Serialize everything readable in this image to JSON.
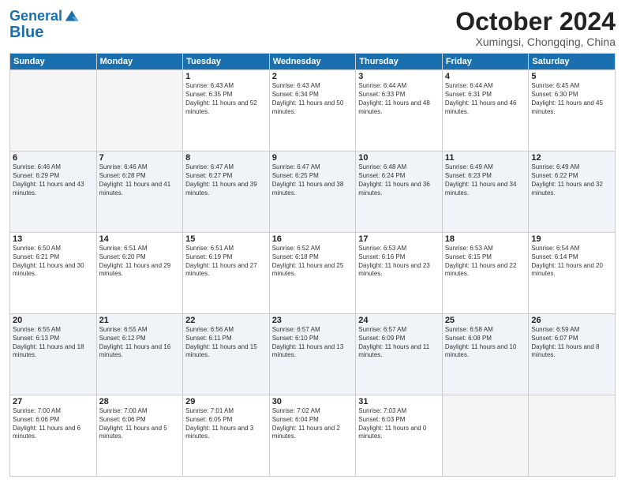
{
  "header": {
    "logo_line1": "General",
    "logo_line2": "Blue",
    "month": "October 2024",
    "location": "Xumingsi, Chongqing, China"
  },
  "weekdays": [
    "Sunday",
    "Monday",
    "Tuesday",
    "Wednesday",
    "Thursday",
    "Friday",
    "Saturday"
  ],
  "weeks": [
    [
      {
        "day": "",
        "info": ""
      },
      {
        "day": "",
        "info": ""
      },
      {
        "day": "1",
        "info": "Sunrise: 6:43 AM\nSunset: 6:35 PM\nDaylight: 11 hours and 52 minutes."
      },
      {
        "day": "2",
        "info": "Sunrise: 6:43 AM\nSunset: 6:34 PM\nDaylight: 11 hours and 50 minutes."
      },
      {
        "day": "3",
        "info": "Sunrise: 6:44 AM\nSunset: 6:33 PM\nDaylight: 11 hours and 48 minutes."
      },
      {
        "day": "4",
        "info": "Sunrise: 6:44 AM\nSunset: 6:31 PM\nDaylight: 11 hours and 46 minutes."
      },
      {
        "day": "5",
        "info": "Sunrise: 6:45 AM\nSunset: 6:30 PM\nDaylight: 11 hours and 45 minutes."
      }
    ],
    [
      {
        "day": "6",
        "info": "Sunrise: 6:46 AM\nSunset: 6:29 PM\nDaylight: 11 hours and 43 minutes."
      },
      {
        "day": "7",
        "info": "Sunrise: 6:46 AM\nSunset: 6:28 PM\nDaylight: 11 hours and 41 minutes."
      },
      {
        "day": "8",
        "info": "Sunrise: 6:47 AM\nSunset: 6:27 PM\nDaylight: 11 hours and 39 minutes."
      },
      {
        "day": "9",
        "info": "Sunrise: 6:47 AM\nSunset: 6:25 PM\nDaylight: 11 hours and 38 minutes."
      },
      {
        "day": "10",
        "info": "Sunrise: 6:48 AM\nSunset: 6:24 PM\nDaylight: 11 hours and 36 minutes."
      },
      {
        "day": "11",
        "info": "Sunrise: 6:49 AM\nSunset: 6:23 PM\nDaylight: 11 hours and 34 minutes."
      },
      {
        "day": "12",
        "info": "Sunrise: 6:49 AM\nSunset: 6:22 PM\nDaylight: 11 hours and 32 minutes."
      }
    ],
    [
      {
        "day": "13",
        "info": "Sunrise: 6:50 AM\nSunset: 6:21 PM\nDaylight: 11 hours and 30 minutes."
      },
      {
        "day": "14",
        "info": "Sunrise: 6:51 AM\nSunset: 6:20 PM\nDaylight: 11 hours and 29 minutes."
      },
      {
        "day": "15",
        "info": "Sunrise: 6:51 AM\nSunset: 6:19 PM\nDaylight: 11 hours and 27 minutes."
      },
      {
        "day": "16",
        "info": "Sunrise: 6:52 AM\nSunset: 6:18 PM\nDaylight: 11 hours and 25 minutes."
      },
      {
        "day": "17",
        "info": "Sunrise: 6:53 AM\nSunset: 6:16 PM\nDaylight: 11 hours and 23 minutes."
      },
      {
        "day": "18",
        "info": "Sunrise: 6:53 AM\nSunset: 6:15 PM\nDaylight: 11 hours and 22 minutes."
      },
      {
        "day": "19",
        "info": "Sunrise: 6:54 AM\nSunset: 6:14 PM\nDaylight: 11 hours and 20 minutes."
      }
    ],
    [
      {
        "day": "20",
        "info": "Sunrise: 6:55 AM\nSunset: 6:13 PM\nDaylight: 11 hours and 18 minutes."
      },
      {
        "day": "21",
        "info": "Sunrise: 6:55 AM\nSunset: 6:12 PM\nDaylight: 11 hours and 16 minutes."
      },
      {
        "day": "22",
        "info": "Sunrise: 6:56 AM\nSunset: 6:11 PM\nDaylight: 11 hours and 15 minutes."
      },
      {
        "day": "23",
        "info": "Sunrise: 6:57 AM\nSunset: 6:10 PM\nDaylight: 11 hours and 13 minutes."
      },
      {
        "day": "24",
        "info": "Sunrise: 6:57 AM\nSunset: 6:09 PM\nDaylight: 11 hours and 11 minutes."
      },
      {
        "day": "25",
        "info": "Sunrise: 6:58 AM\nSunset: 6:08 PM\nDaylight: 11 hours and 10 minutes."
      },
      {
        "day": "26",
        "info": "Sunrise: 6:59 AM\nSunset: 6:07 PM\nDaylight: 11 hours and 8 minutes."
      }
    ],
    [
      {
        "day": "27",
        "info": "Sunrise: 7:00 AM\nSunset: 6:06 PM\nDaylight: 11 hours and 6 minutes."
      },
      {
        "day": "28",
        "info": "Sunrise: 7:00 AM\nSunset: 6:06 PM\nDaylight: 11 hours and 5 minutes."
      },
      {
        "day": "29",
        "info": "Sunrise: 7:01 AM\nSunset: 6:05 PM\nDaylight: 11 hours and 3 minutes."
      },
      {
        "day": "30",
        "info": "Sunrise: 7:02 AM\nSunset: 6:04 PM\nDaylight: 11 hours and 2 minutes."
      },
      {
        "day": "31",
        "info": "Sunrise: 7:03 AM\nSunset: 6:03 PM\nDaylight: 11 hours and 0 minutes."
      },
      {
        "day": "",
        "info": ""
      },
      {
        "day": "",
        "info": ""
      }
    ]
  ]
}
